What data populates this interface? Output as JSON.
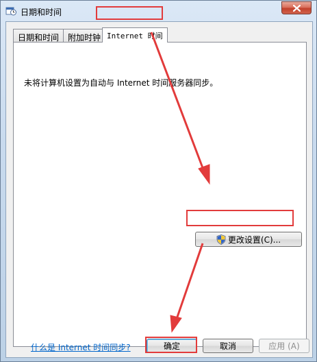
{
  "window": {
    "title": "日期和时间"
  },
  "tabs": [
    {
      "label": "日期和时间",
      "active": false
    },
    {
      "label": "附加时钟",
      "active": false
    },
    {
      "label": "Internet 时间",
      "active": true
    }
  ],
  "panel": {
    "status_text": "未将计算机设置为自动与 Internet 时间服务器同步。",
    "change_settings_label": "更改设置(C)...",
    "help_link": "什么是 Internet 时间同步?"
  },
  "footer": {
    "ok_label": "确定",
    "cancel_label": "取消",
    "apply_label": "应用 (A)"
  },
  "icons": {
    "title": "date-time-clock-icon",
    "close": "close-icon",
    "uac": "uac-shield-icon"
  },
  "colors": {
    "annotation_red": "#e23b3b",
    "link_blue": "#0066cc",
    "close_red": "#c2412c"
  }
}
